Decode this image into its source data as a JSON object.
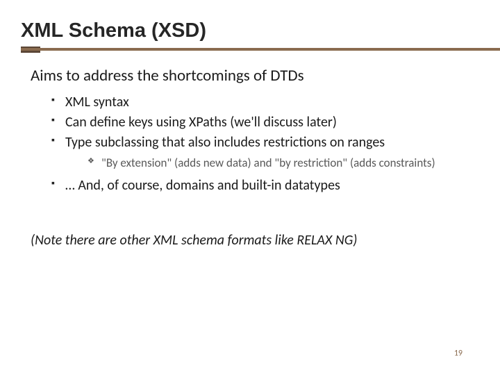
{
  "title": "XML Schema (XSD)",
  "lead": "Aims to address the shortcomings of DTDs",
  "bullets": {
    "b0": "XML syntax",
    "b1": "Can define keys using XPaths (we'll discuss later)",
    "b2": "Type subclassing that also includes restrictions on ranges",
    "b2_sub0": "\"By extension\" (adds new data) and \"by restriction\" (adds constraints)",
    "b3": "… And, of course, domains and built-in datatypes"
  },
  "note": "(Note there are other XML schema formats like RELAX NG)",
  "page_number": "19",
  "colors": {
    "accent_dark": "#5b4636",
    "accent": "#8a6b4f"
  }
}
